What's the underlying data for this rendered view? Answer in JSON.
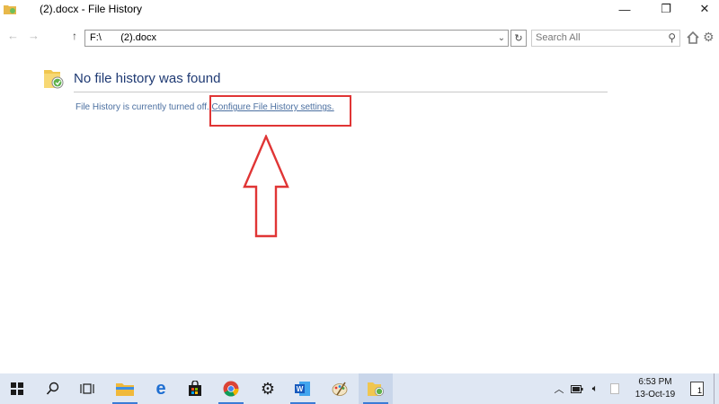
{
  "window": {
    "title": "(2).docx - File History",
    "controls": {
      "minimize": "—",
      "maximize": "❐",
      "close": "✕"
    }
  },
  "toolbar": {
    "address": "F:\\       (2).docx",
    "search_placeholder": "Search All"
  },
  "main": {
    "heading": "No file history was found",
    "status_text": "File History is currently turned off. ",
    "settings_link": "Configure File History settings."
  },
  "annotation": {
    "color": "#e03535"
  },
  "taskbar": {
    "items": [
      "start-icon",
      "search-icon",
      "task-view-icon",
      "file-explorer-icon",
      "edge-icon",
      "store-icon",
      "chrome-icon",
      "settings-icon",
      "word-icon",
      "paint-icon",
      "file-history-icon"
    ],
    "clock_time": "6:53 PM",
    "clock_date": "13-Oct-19",
    "notification_count": "1"
  },
  "colors": {
    "heading": "#1f3a73",
    "link": "#4b6fa0",
    "taskbar": "#dfe7f3",
    "accent": "#3b7bd6"
  }
}
